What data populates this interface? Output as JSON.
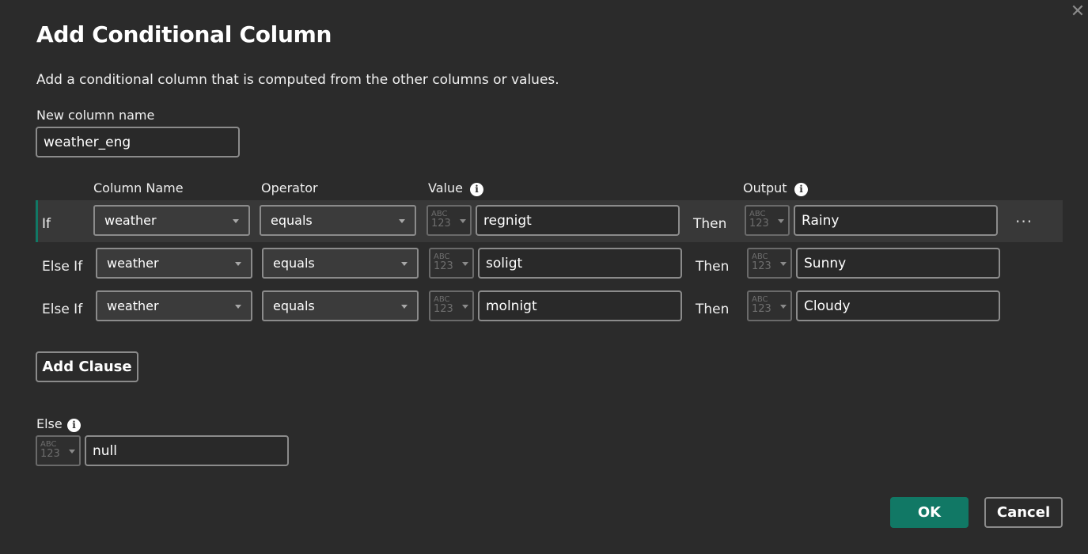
{
  "dialog": {
    "title": "Add Conditional Column",
    "description": "Add a conditional column that is computed from the other columns or values.",
    "close_glyph": "✕"
  },
  "new_column": {
    "label": "New column name",
    "value": "weather_eng"
  },
  "headers": {
    "column_name": "Column Name",
    "operator": "Operator",
    "value": "Value",
    "output": "Output"
  },
  "rows": [
    {
      "prefix": "If",
      "column": "weather",
      "operator": "equals",
      "value": "regnigt",
      "then": "Then",
      "output": "Rainy"
    },
    {
      "prefix": "Else If",
      "column": "weather",
      "operator": "equals",
      "value": "soligt",
      "then": "Then",
      "output": "Sunny"
    },
    {
      "prefix": "Else If",
      "column": "weather",
      "operator": "equals",
      "value": "molnigt",
      "then": "Then",
      "output": "Cloudy"
    }
  ],
  "type_glyph": {
    "top": "ABC",
    "bottom": "123"
  },
  "info_glyph": "i",
  "more_glyph": "···",
  "add_clause_label": "Add Clause",
  "else": {
    "label": "Else",
    "value": "null"
  },
  "footer": {
    "ok_label": "OK",
    "cancel_label": "Cancel"
  },
  "colors": {
    "background": "#2b2b2b",
    "accent": "#117865",
    "border": "#8b8b8b"
  }
}
